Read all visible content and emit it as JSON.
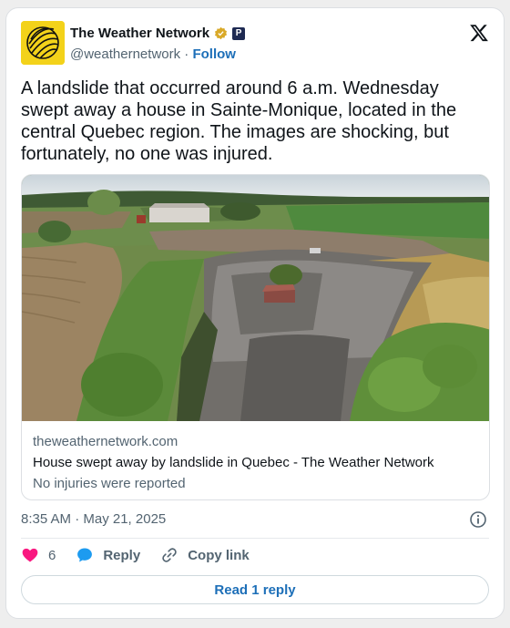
{
  "account": {
    "display_name": "The Weather Network",
    "handle": "@weathernetwork",
    "separator": "·",
    "follow_label": "Follow"
  },
  "tweet": {
    "text": "A landslide that occurred around 6 a.m. Wednesday swept away a house in Sainte-Monique, located in the central Quebec region. The images are shocking, but fortunately, no one was injured."
  },
  "link_card": {
    "domain": "theweathernetwork.com",
    "title": "House swept away by landslide in Quebec - The Weather Network",
    "description": "No injuries were reported"
  },
  "meta": {
    "timestamp": "8:35 AM · May 21, 2025"
  },
  "actions": {
    "like_count": "6",
    "reply_label": "Reply",
    "copy_link_label": "Copy link"
  },
  "read_replies_label": "Read 1 reply",
  "colors": {
    "link_blue": "#1d6fb8",
    "like_pink": "#f91880",
    "reply_blue": "#1d9bf0",
    "avatar_yellow": "#f3d21a"
  }
}
